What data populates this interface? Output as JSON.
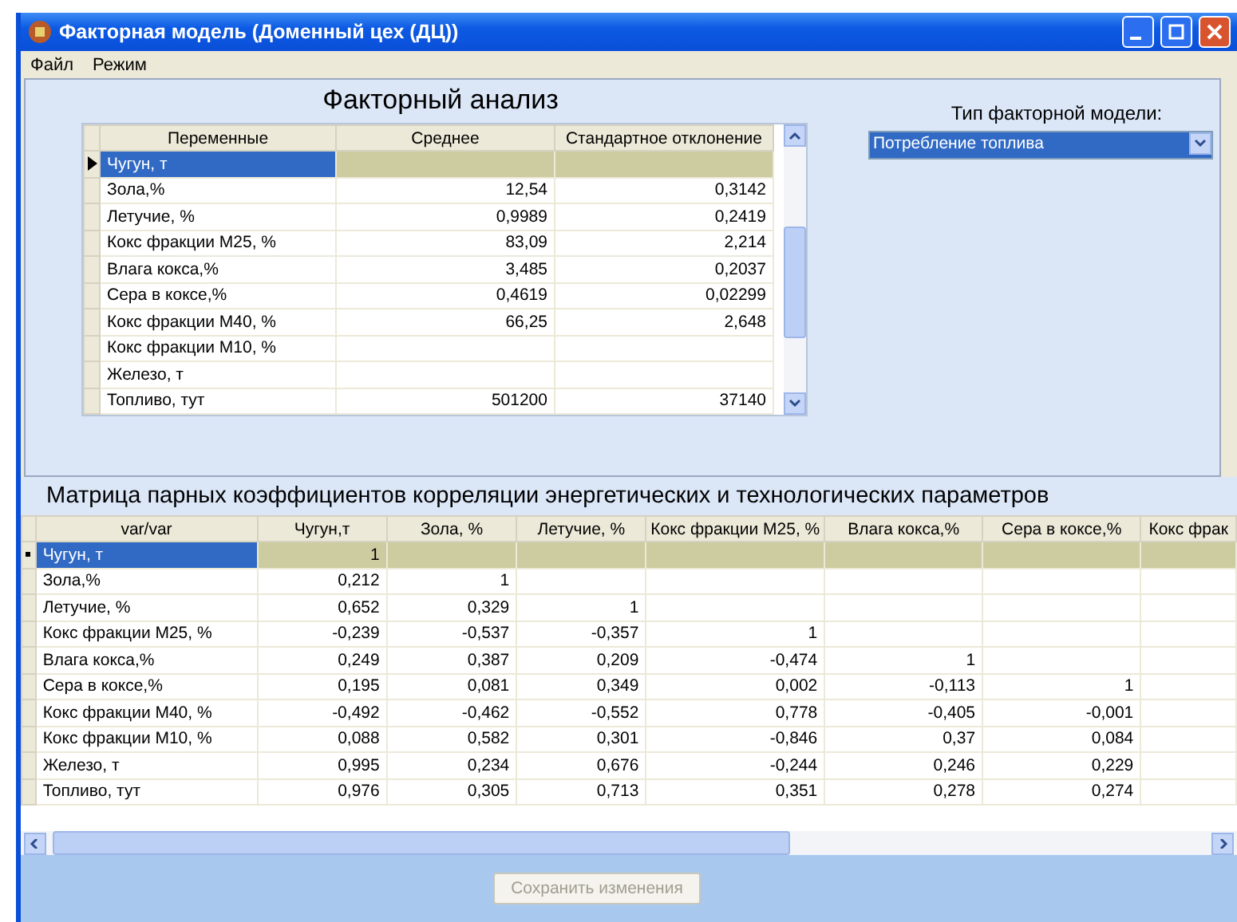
{
  "window": {
    "title": "Факторная модель (Доменный цех (ДЦ))"
  },
  "menu": [
    "Файл",
    "Режим"
  ],
  "analysis": {
    "title": "Факторный анализ",
    "columns": [
      "Переменные",
      "Среднее",
      "Стандартное отклонение"
    ],
    "rows": [
      {
        "name": "Чугун, т",
        "selected": true
      },
      {
        "name": "Зола,%",
        "selected": false,
        "mean": "12,54",
        "std": "0,3142"
      },
      {
        "name": "Летучие, %",
        "selected": false,
        "mean": "0,9989",
        "std": "0,2419"
      },
      {
        "name": "Кокс фракции М25, %",
        "selected": false,
        "mean": "83,09",
        "std": "2,214"
      },
      {
        "name": "Влага кокса,%",
        "selected": false,
        "mean": "3,485",
        "std": "0,2037"
      },
      {
        "name": "Сера в коксе,%",
        "selected": false,
        "mean": "0,4619",
        "std": "0,02299"
      },
      {
        "name": "Кокс фракции М40, %",
        "selected": false,
        "mean": "66,25",
        "std": "2,648"
      },
      {
        "name": "Кокс фракции М10, %",
        "selected": false
      },
      {
        "name": "Железо, т",
        "selected": false
      },
      {
        "name": "Топливо, тут",
        "selected": false,
        "mean": "501200",
        "std": "37140"
      }
    ]
  },
  "model_type": {
    "label": "Тип факторной модели:",
    "value": "Потребление топлива"
  },
  "correlation": {
    "title": "Матрица парных коэффициентов корреляции энергетических и технологических параметров",
    "columns": [
      "var/var",
      "Чугун,т",
      "Зола, %",
      "Летучие, %",
      "Кокс фракции М25, %",
      "Влага кокса,%",
      "Сера в коксе,%",
      "Кокс фрак"
    ],
    "rows": [
      {
        "name": "Чугун, т",
        "selected": true,
        "values": [
          "1"
        ]
      },
      {
        "name": "Зола,%",
        "selected": false,
        "values": [
          "0,212",
          "1"
        ]
      },
      {
        "name": "Летучие, %",
        "selected": false,
        "values": [
          "0,652",
          "0,329",
          "1"
        ]
      },
      {
        "name": "Кокс фракции М25, %",
        "selected": false,
        "values": [
          "-0,239",
          "-0,537",
          "-0,357",
          "1"
        ]
      },
      {
        "name": "Влага кокса,%",
        "selected": false,
        "values": [
          "0,249",
          "0,387",
          "0,209",
          "-0,474",
          "1"
        ]
      },
      {
        "name": "Сера в коксе,%",
        "selected": false,
        "values": [
          "0,195",
          "0,081",
          "0,349",
          "0,002",
          "-0,113",
          "1"
        ]
      },
      {
        "name": "Кокс фракции М40, %",
        "selected": false,
        "values": [
          "-0,492",
          "-0,462",
          "-0,552",
          "0,778",
          "-0,405",
          "-0,001"
        ]
      },
      {
        "name": "Кокс фракции М10, %",
        "selected": false,
        "values": [
          "0,088",
          "0,582",
          "0,301",
          "-0,846",
          "0,37",
          "0,084"
        ]
      },
      {
        "name": "Железо, т",
        "selected": false,
        "values": [
          "0,995",
          "0,234",
          "0,676",
          "-0,244",
          "0,246",
          "0,229"
        ]
      },
      {
        "name": "Топливо, тут",
        "selected": false,
        "values": [
          "0,976",
          "0,305",
          "0,713",
          "0,351",
          "0,278",
          "0,274"
        ]
      }
    ]
  },
  "save_button": {
    "label": "Сохранить изменения",
    "disabled": true
  }
}
